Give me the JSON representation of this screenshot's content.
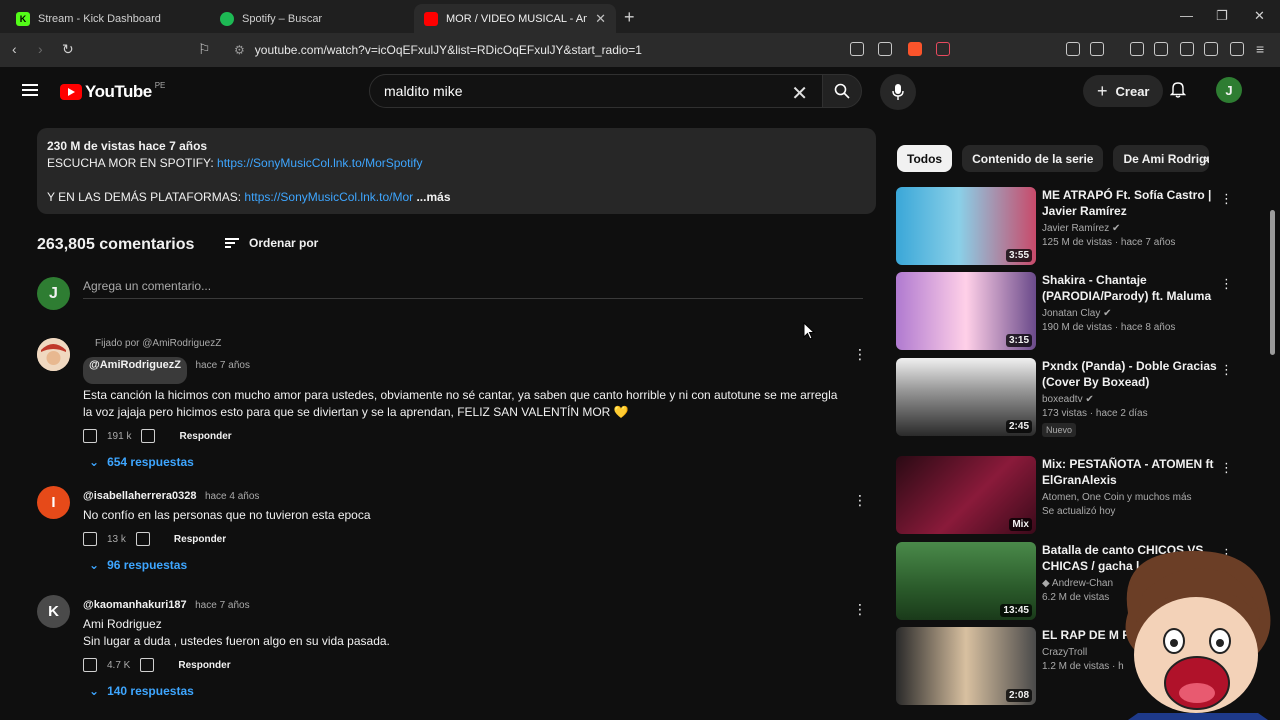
{
  "browser": {
    "tabs": [
      {
        "label": "Stream - Kick Dashboard",
        "icon": "kick-icon",
        "color": "#53fc18"
      },
      {
        "label": "Spotify – Buscar",
        "icon": "spotify-icon",
        "color": "#1db954"
      },
      {
        "label": "MOR / VIDEO MUSICAL - Ami Ro",
        "icon": "youtube-icon",
        "color": "#ff0000"
      }
    ],
    "url": "youtube.com/watch?v=icOqEFxulJY&list=RDicOqEFxulJY&start_radio=1"
  },
  "header": {
    "logo_text": "YouTube",
    "country": "PE",
    "search_value": "maldito mike",
    "create_label": "Crear",
    "avatar_letter": "J"
  },
  "description": {
    "meta": "230 M de vistas  hace 7 años",
    "line1_prefix": "ESCUCHA MOR EN SPOTIFY: ",
    "line1_link": "https://SonyMusicCol.lnk.to/MorSpotify",
    "line2_prefix": "Y EN LAS DEMÁS PLATAFORMAS: ",
    "line2_link": "https://SonyMusicCol.lnk.to/Mor",
    "more": "...más"
  },
  "comments": {
    "count_label": "263,805 comentarios",
    "sort_label": "Ordenar por",
    "add_placeholder": "Agrega un comentario...",
    "add_avatar": "J",
    "items": [
      {
        "pinned": "Fijado por @AmiRodriguezZ",
        "author": "@AmiRodriguezZ",
        "time": "hace 7 años",
        "text": "Esta canción la hicimos con mucho amor para ustedes, obviamente no sé cantar, ya saben que canto horrible y ni con autotune se me arregla la voz jajaja pero hicimos esto para que se diviertan y se la aprendan, FELIZ SAN VALENTÍN MOR 💛",
        "likes": "191 k",
        "reply": "Responder",
        "replies": "654 respuestas"
      },
      {
        "author": "@isabellaherrera0328",
        "time": "hace 4 años",
        "text": "No confío en las personas que no tuvieron esta epoca",
        "likes": "13 k",
        "reply": "Responder",
        "replies": "96 respuestas",
        "avatar": "I"
      },
      {
        "author": "@kaomanhakuri187",
        "time": "hace 7 años",
        "text": "Ami Rodriguez\nSin lugar a duda , ustedes fueron algo en su vida pasada.",
        "likes": "4.7 K",
        "reply": "Responder",
        "replies": "140 respuestas",
        "avatar": "K"
      }
    ]
  },
  "sidebar": {
    "chips": [
      "Todos",
      "Contenido de la serie",
      "De Ami Rodrigue"
    ],
    "videos": [
      {
        "title": "ME ATRAPÓ Ft. Sofía Castro | Javier Ramírez",
        "channel": "Javier Ramírez ✔",
        "stats": "125 M de vistas · hace 7 años",
        "duration": "3:55",
        "colors": [
          "#3aa7d8",
          "#c84a6a"
        ]
      },
      {
        "title": "Shakira - Chantaje (PARODIA/Parody) ft. Maluma ...",
        "channel": "Jonatan Clay ✔",
        "stats": "190 M de vistas · hace 8 años",
        "duration": "3:15",
        "colors": [
          "#b07ad0",
          "#ffd0e8"
        ]
      },
      {
        "title": "Pxndx (Panda) - Doble Gracias (Cover By Boxead)",
        "channel": "boxeadtv ✔",
        "stats": "173 vistas · hace 2 días",
        "duration": "2:45",
        "badge": "Nuevo",
        "colors": [
          "#e8e8e8",
          "#555"
        ]
      },
      {
        "title": "Mix: PESTAÑOTA - ATOMEN ft ElGranAlexis",
        "channel": "Atomen, One Coin y muchos más",
        "stats": "Se actualizó hoy",
        "duration": "Mix",
        "colors": [
          "#2a0a14",
          "#8a1a3a"
        ]
      },
      {
        "title": "Batalla de canto CHICOS VS CHICAS / gacha l",
        "channel": "◆ Andrew-Chan",
        "stats": "6.2 M de vistas",
        "duration": "13:45",
        "colors": [
          "#4a8a4a",
          "#1a3a1a"
        ]
      },
      {
        "title": "EL RAP DE M ROBERTO",
        "channel": "CrazyTroll",
        "stats": "1.2 M de vistas · h",
        "duration": "2:08",
        "colors": [
          "#d8c0a0",
          "#2a2a2a"
        ]
      }
    ]
  }
}
